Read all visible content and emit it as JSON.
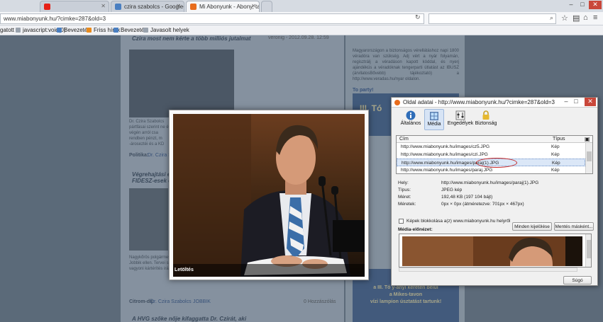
{
  "browser": {
    "tabs": [
      {
        "label": "",
        "favicon_color": "#e62117"
      },
      {
        "label": "czira szabolcs - Google-keresés",
        "favicon_color": "#4a7fc1"
      },
      {
        "label": "Mi Abonyunk - Abony, tabul...",
        "favicon_color": "#e86c1c"
      }
    ],
    "url": "www.miabonyunk.hu/?cimke=287&old=3",
    "bookmarks": [
      "gatott",
      "javascript:void(0)",
      "Bevezetés",
      "Friss hírek",
      "Bevezetés",
      "Javasolt helyek"
    ]
  },
  "page": {
    "article1": {
      "title": "Czira most nem kérte a több milliós jutalmat",
      "meta": "veronig - 2012.09.28. 12:59",
      "politics_label": "Politika:",
      "politics_link": "Dr. Czira S"
    },
    "article2": {
      "title": "Végrehajtási e...",
      "subtitle": "FIDESZ-esek e...",
      "citrom_label": "Citrom-díj:",
      "citrom_link": "Dr. Czira Szabolcs",
      "party_link": "JOBBIK",
      "comments": "0 Hozzászólás"
    },
    "article3": {
      "title": "A HVG szőke nője kifaggatta Dr. Czirát, aki"
    },
    "right": {
      "to_party": "To party!",
      "banner_text": "III. Tó",
      "bottom_line1": "a III. Tó y-ányi kereten belül",
      "bottom_line2": "a Mikes-tavon",
      "bottom_line3": "vízi lampion úsztatást tartunk!"
    }
  },
  "lightbox": {
    "download_label": "Letöltés"
  },
  "dialog": {
    "title": "Oldal adatai - http://www.miabonyunk.hu/?cimke=287&old=3",
    "tabs": [
      {
        "label": "Általános",
        "icon": "info-icon"
      },
      {
        "label": "Média",
        "icon": "media-icon"
      },
      {
        "label": "Engedélyek",
        "icon": "permissions-icon"
      },
      {
        "label": "Biztonság",
        "icon": "lock-icon"
      }
    ],
    "list": {
      "col_address": "Cím",
      "col_type": "Típus",
      "rows": [
        {
          "address": "http://www.miabonyunk.hu/images/cz5.JPG",
          "type": "Kép"
        },
        {
          "address": "http://www.miabonyunk.hu/images/czi.JPG",
          "type": "Kép"
        },
        {
          "address": "http://www.miabonyunk.hu/images/paraj(1).JPG",
          "type": "Kép"
        },
        {
          "address": "http://www.miabonyunk.hu/images/paraj.JPG",
          "type": "Kép"
        }
      ],
      "selected_index": 2
    },
    "properties": [
      {
        "label": "Hely:",
        "value": "http://www.miabonyunk.hu/images/paraj(1).JPG"
      },
      {
        "label": "Típus:",
        "value": "JPEG kép"
      },
      {
        "label": "Méret:",
        "value": "192,48 KB (197 104 bájt)"
      },
      {
        "label": "Méretek:",
        "value": "0px × 0px (átméretezve: 701px × 467px)"
      }
    ],
    "block_label": "Képek blokkolása a(z) www.miabonyunk.hu helyről",
    "select_all_button": "Minden kijelölése",
    "save_as_button": "Mentés másként...",
    "preview_label": "Média-előnézet:",
    "help_button": "Súgó"
  }
}
